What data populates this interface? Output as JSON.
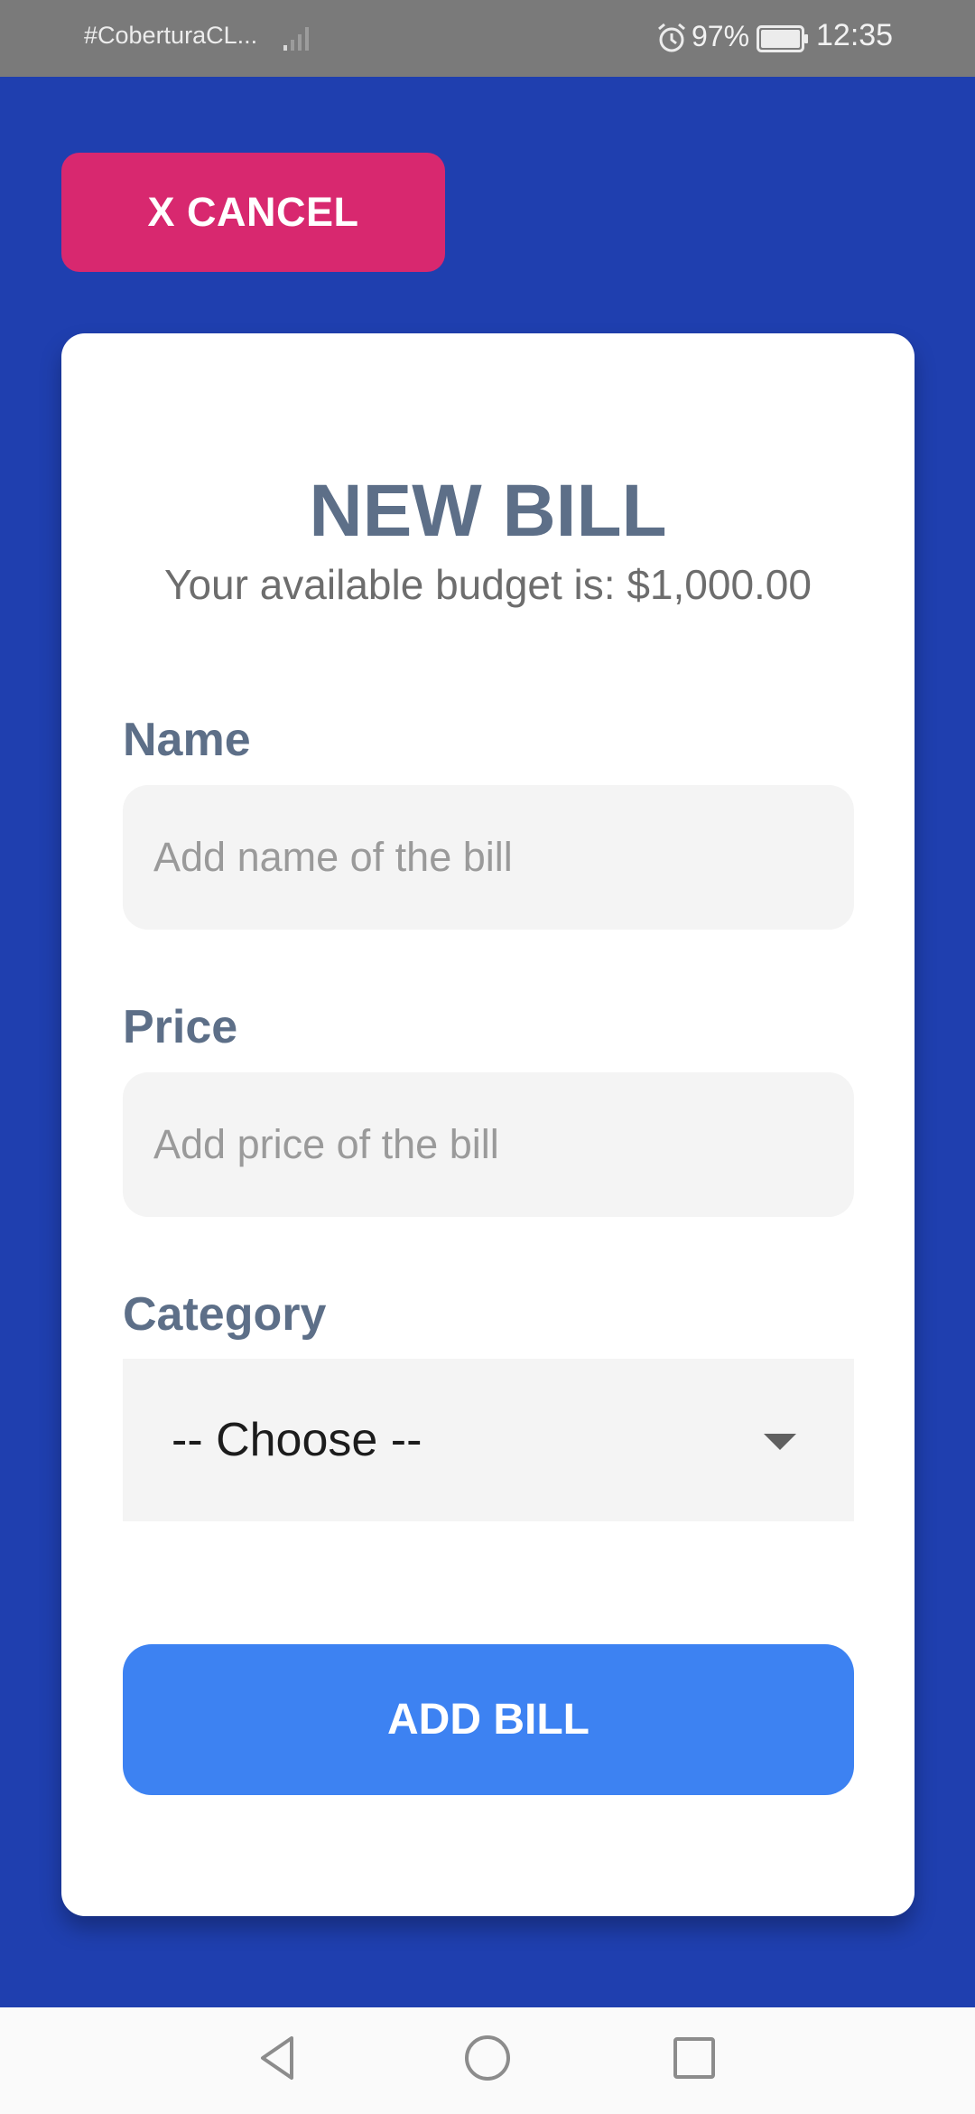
{
  "status_bar": {
    "carrier": "#CoberturaCL...",
    "battery_percent": "97%",
    "time": "12:35",
    "icons": [
      "signal-icon",
      "alarm-icon",
      "battery-icon"
    ]
  },
  "actions": {
    "cancel_label": "X CANCEL",
    "add_label": "ADD BILL"
  },
  "form": {
    "title": "NEW BILL",
    "budget_text": "Your available budget is: $1,000.00",
    "name_label": "Name",
    "name_placeholder": "Add name of the bill",
    "name_value": "",
    "price_label": "Price",
    "price_placeholder": "Add price of the bill",
    "price_value": "",
    "category_label": "Category",
    "category_selected": "-- Choose --"
  },
  "nav": {
    "buttons": [
      "back-icon",
      "home-icon",
      "recents-icon"
    ]
  },
  "colors": {
    "background": "#1f3faf",
    "cancel": "#d8286f",
    "primary": "#3d82f2",
    "label": "#5d6f88"
  }
}
